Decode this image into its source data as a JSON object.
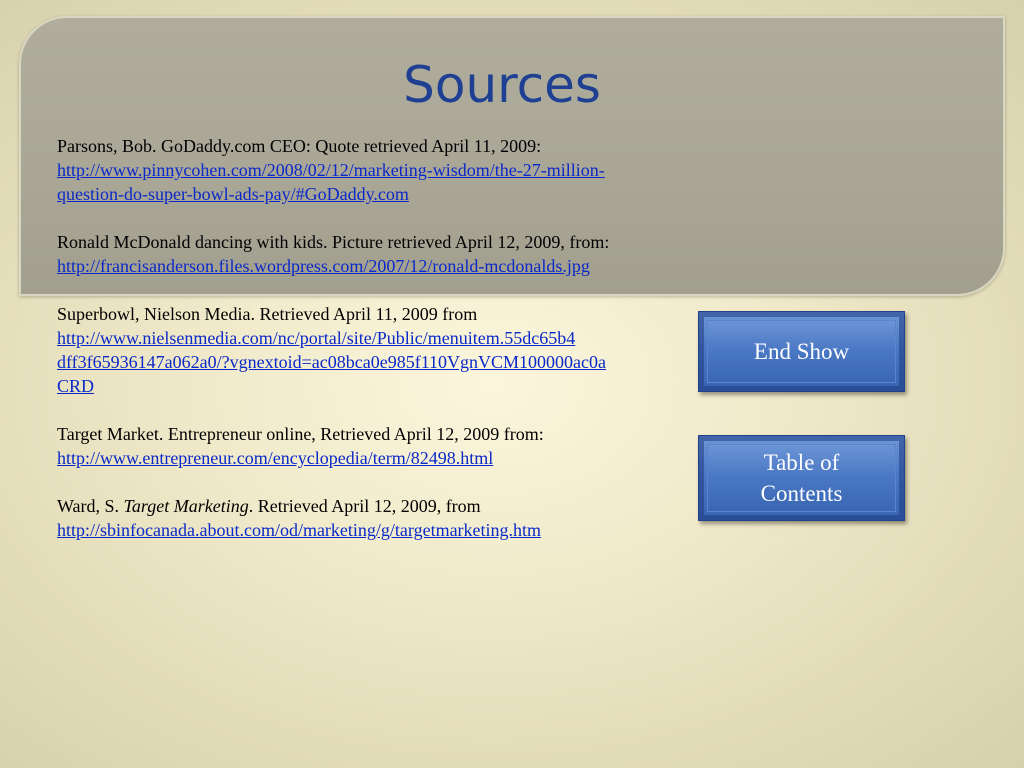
{
  "slide": {
    "title": "Sources"
  },
  "sources": [
    {
      "text": "Parsons, Bob. GoDaddy.com CEO: Quote retrieved April 11, 2009:",
      "link_lines": [
        "http://www.pinnycohen.com/2008/02/12/marketing-wisdom/the-27-million-",
        "question-do-super-bowl-ads-pay/#GoDaddy.com"
      ]
    },
    {
      "text": "Ronald McDonald dancing with kids. Picture retrieved April 12, 2009, from:",
      "link_lines": [
        "http://francisanderson.files.wordpress.com/2007/12/ronald-mcdonalds.jpg"
      ]
    },
    {
      "text": "Superbowl, Nielson Media. Retrieved April 11, 2009 from",
      "link_lines": [
        "http://www.nielsenmedia.com/nc/portal/site/Public/menuitem.55dc65b4",
        "dff3f65936147a062a0/?vgnextoid=ac08bca0e985f110VgnVCM100000ac0a",
        "CRD"
      ]
    },
    {
      "text": "Target Market. Entrepreneur online, Retrieved April 12, 2009 from:",
      "link_lines": [
        "http://www.entrepreneur.com/encyclopedia/term/82498.html"
      ]
    },
    {
      "author": "Ward, S. ",
      "title_italic": "Target Marketing",
      "rest": ". Retrieved April 12, 2009, from",
      "link_lines": [
        "http://sbinfocanada.about.com/od/marketing/g/targetmarketing.htm"
      ]
    }
  ],
  "buttons": {
    "end_show": "End Show",
    "table_of_contents": "Table of Contents"
  },
  "colors": {
    "title": "#1f3f93",
    "link": "#0b28c8",
    "button": "#4b78c4",
    "header_panel": "#a9a696"
  }
}
